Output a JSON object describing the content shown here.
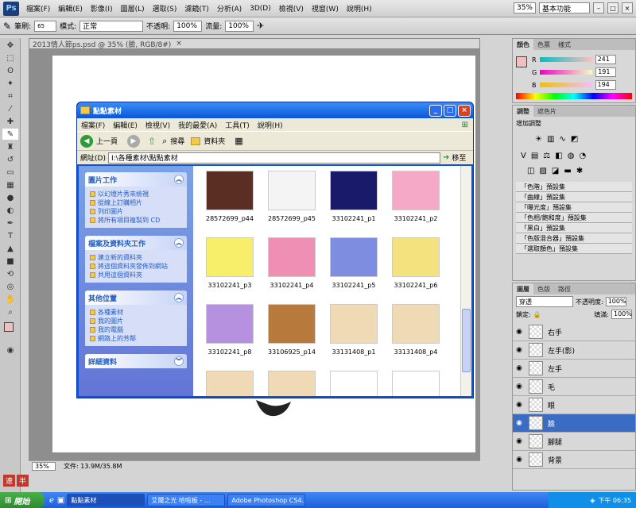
{
  "ps": {
    "logo": "Ps",
    "menus": [
      "檔案(F)",
      "編輯(E)",
      "影像(I)",
      "圖層(L)",
      "選取(S)",
      "濾鏡(T)",
      "分析(A)",
      "3D(D)",
      "檢視(V)",
      "視窗(W)",
      "說明(H)"
    ],
    "zoom": "35%",
    "workspace": "基本功能"
  },
  "options": {
    "brush_label": "筆刷:",
    "brush_size": "65",
    "mode_label": "模式:",
    "mode_value": "正常",
    "opacity_label": "不透明:",
    "opacity_value": "100%",
    "flow_label": "流量:",
    "flow_value": "100%"
  },
  "document": {
    "tab_title": "2013情人節ps.psd @ 35% (臉, RGB/8#)",
    "status_zoom": "35%",
    "status_file": "文件: 13.9M/35.8M"
  },
  "color_panel": {
    "tabs": [
      "顏色",
      "色票",
      "樣式"
    ],
    "r_label": "R",
    "r_value": "241",
    "g_label": "G",
    "g_value": "191",
    "b_label": "B",
    "b_value": "194",
    "swatch_color": "#f1bfc2"
  },
  "adjust_panel": {
    "tabs": [
      "調整",
      "遮色片"
    ],
    "heading": "增加調整",
    "presets": [
      "「色階」預設集",
      "「曲線」預設集",
      "「曝光度」預設集",
      "「色相/飽和度」預設集",
      "「黑白」預設集",
      "「色版混合器」預設集",
      "「選取顏色」預設集"
    ]
  },
  "layers_panel": {
    "tabs": [
      "圖層",
      "色版",
      "路徑"
    ],
    "blend_mode": "穿透",
    "opacity_label": "不透明度:",
    "opacity_value": "100%",
    "lock_label": "鎖定:",
    "fill_label": "填滿:",
    "fill_value": "100%",
    "layers": [
      "右手",
      "左手(影)",
      "左手",
      "毛",
      "眼",
      "臉",
      "腳腿",
      "背景"
    ],
    "selected_index": 5
  },
  "explorer": {
    "title": "點點素材",
    "menus": [
      "檔案(F)",
      "編輯(E)",
      "檢視(V)",
      "我的最愛(A)",
      "工具(T)",
      "說明(H)"
    ],
    "toolbar": {
      "back": "上一頁",
      "search": "搜尋",
      "folders": "資料夾"
    },
    "address_label": "網址(D)",
    "address_value": "I:\\各種素材\\點點素材",
    "go_label": "移至",
    "side": {
      "picture_tasks_title": "圖片工作",
      "picture_tasks": [
        "以幻燈片秀來檢視",
        "從線上訂購相片",
        "列印圖片",
        "將所有項目複製到 CD"
      ],
      "file_tasks_title": "檔案及資料夾工作",
      "file_tasks": [
        "建立新的資料夾",
        "將這個資料夾發佈到網站",
        "共用這個資料夾"
      ],
      "other_title": "其他位置",
      "other": [
        "各種素材",
        "我的圖片",
        "我的電腦",
        "網路上的芳鄰"
      ],
      "details_title": "詳細資料"
    },
    "files": [
      {
        "name": "28572699_p44",
        "fill": "#5a2e23"
      },
      {
        "name": "28572699_p45",
        "fill": "#f4f4f4"
      },
      {
        "name": "33102241_p1",
        "fill": "#1a1a6a"
      },
      {
        "name": "33102241_p2",
        "fill": "#f5a9c6"
      },
      {
        "name": "33102241_p3",
        "fill": "#f7ef6a"
      },
      {
        "name": "33102241_p4",
        "fill": "#ef8fb3"
      },
      {
        "name": "33102241_p5",
        "fill": "#7e8de0"
      },
      {
        "name": "33102241_p6",
        "fill": "#f4e27e"
      },
      {
        "name": "33102241_p8",
        "fill": "#b691e0"
      },
      {
        "name": "33106925_p14",
        "fill": "#b8793c"
      },
      {
        "name": "33131408_p1",
        "fill": "#f0d9b5"
      },
      {
        "name": "33131408_p4",
        "fill": "#f0d9b5"
      }
    ]
  },
  "taskbar": {
    "start": "開始",
    "tasks": [
      "點點素材",
      "艾爾之光 哈啦板 - ...",
      "Adobe Photoshop CS4..."
    ],
    "clock": "下午 06:35"
  },
  "ime": {
    "label1": "速",
    "label2": "半"
  }
}
